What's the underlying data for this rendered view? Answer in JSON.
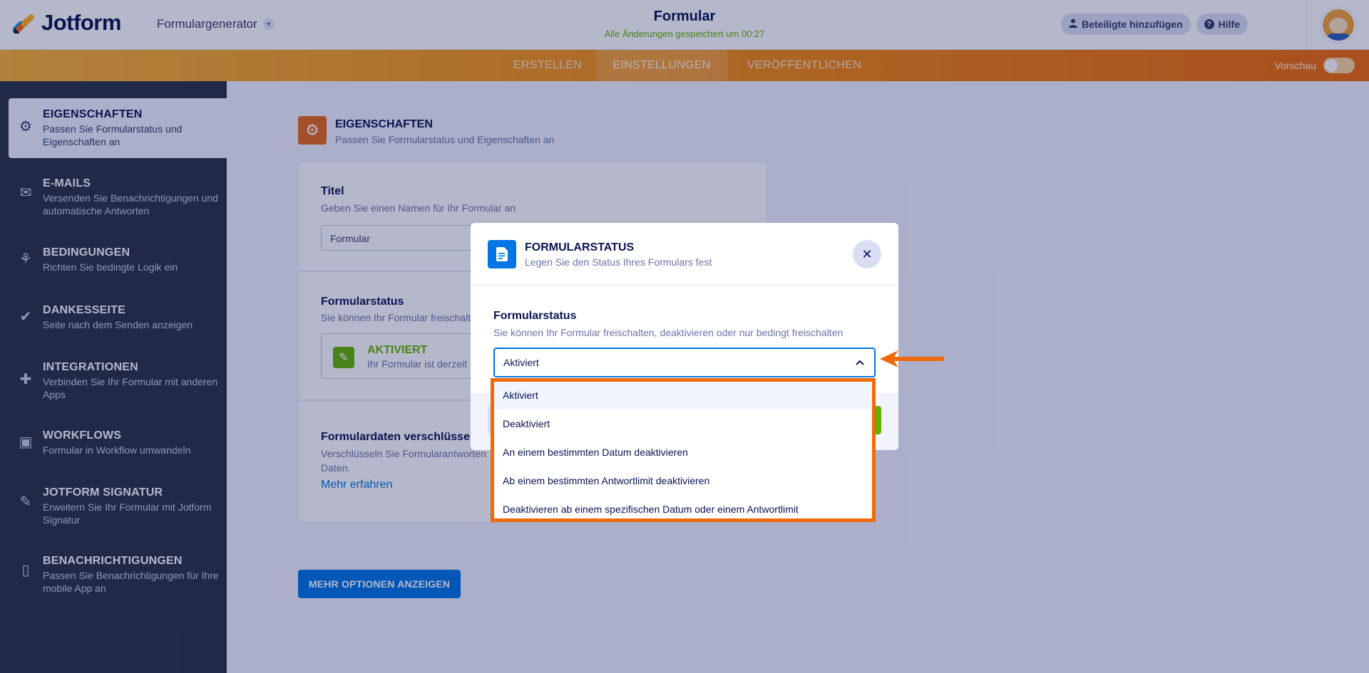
{
  "app": {
    "logo_text": "Jotform",
    "generator_label": "Formulargenerator",
    "form_title": "Formular",
    "save_status": "Alle Änderungen gespeichert um 00:27",
    "share_button": "Beteiligte hinzufügen",
    "help_button": "Hilfe"
  },
  "nav": {
    "tabs": [
      {
        "label": "ERSTELLEN",
        "active": false
      },
      {
        "label": "EINSTELLUNGEN",
        "active": true
      },
      {
        "label": "VERÖFFENTLICHEN",
        "active": false
      }
    ],
    "preview_label": "Vorschau"
  },
  "sidebar": {
    "items": [
      {
        "title": "EIGENSCHAFTEN",
        "desc": "Passen Sie Formularstatus und Eigenschaften an",
        "icon": "gear-icon",
        "active": true
      },
      {
        "title": "E-MAILS",
        "desc": "Versenden Sie Benachrichtigungen und automatische Antworten",
        "icon": "mail-icon",
        "active": false
      },
      {
        "title": "BEDINGUNGEN",
        "desc": "Richten Sie bedingte Logik ein",
        "icon": "logic-icon",
        "active": false
      },
      {
        "title": "DANKESSEITE",
        "desc": "Seite nach dem Senden anzeigen",
        "icon": "check-circle-icon",
        "active": false
      },
      {
        "title": "INTEGRATIONEN",
        "desc": "Verbinden Sie Ihr Formular mit anderen Apps",
        "icon": "puzzle-icon",
        "active": false
      },
      {
        "title": "WORKFLOWS",
        "desc": "Formular in Workflow umwandeln",
        "icon": "workflow-icon",
        "active": false
      },
      {
        "title": "JOTFORM SIGNATUR",
        "desc": "Erweitern Sie Ihr Formular mit Jotform Signatur",
        "icon": "pen-icon",
        "active": false
      },
      {
        "title": "BENACHRICHTIGUNGEN",
        "desc": "Passen Sie Benachrichtigungen für Ihre mobile App an",
        "icon": "mobile-icon",
        "active": false
      }
    ]
  },
  "main": {
    "title": "EIGENSCHAFTEN",
    "subtitle": "Passen Sie Formularstatus und Eigenschaften an",
    "title_section": {
      "label": "Titel",
      "desc": "Geben Sie einen Namen für Ihr Formular an",
      "value": "Formular"
    },
    "status_section": {
      "label": "Formularstatus",
      "desc": "Sie können Ihr Formular freischalten",
      "status_title": "AKTIVIERT",
      "status_desc": "Ihr Formular ist derzeit"
    },
    "encrypt_section": {
      "label": "Formulardaten verschlüsseln",
      "desc_line1": "Verschlüsseln Sie Formularantworten",
      "desc_line2": "Daten.",
      "link": "Mehr erfahren"
    },
    "more_options_button": "MEHR OPTIONEN ANZEIGEN"
  },
  "modal": {
    "title": "FORMULARSTATUS",
    "subtitle": "Legen Sie den Status Ihres Formulars fest",
    "field_label": "Formularstatus",
    "field_desc": "Sie können Ihr Formular freischalten, deaktivieren oder nur bedingt freischalten",
    "selected_value": "Aktiviert",
    "options": [
      "Aktiviert",
      "Deaktiviert",
      "An einem bestimmten Datum deaktivieren",
      "Ab einem bestimmten Antwortlimit deaktivieren",
      "Deaktivieren ab einem spezifischen Datum oder einem Antwortlimit"
    ]
  },
  "colors": {
    "accent_orange": "#f06a0a",
    "primary_blue": "#0075e3",
    "success_green": "#64b200",
    "sidebar_bg": "#2c3345"
  }
}
